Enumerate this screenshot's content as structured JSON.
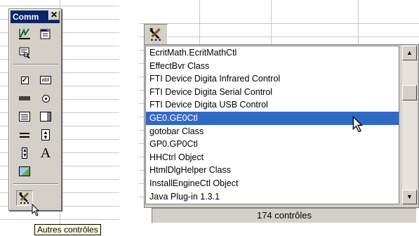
{
  "toolbox": {
    "title": "Comm",
    "close_label": "✕",
    "tooltip": "Autres contrôles"
  },
  "controls_list": {
    "items": [
      "EcritMath.EcritMathCtl",
      "EffectBvr Class",
      "FTI Device Digita Infrared Control",
      "FTI Device Digita Serial Control",
      "FTI Device Digita USB Control",
      "GE0.GE0Ctl",
      "gotobar Class",
      "GP0.GP0Ctl",
      "HHCtrl Object",
      "HtmlDlgHelper Class",
      "InstallEngineCtl Object",
      "Java Plug-in 1.3.1"
    ],
    "selected_index": 5,
    "count_label": "174 contrôles",
    "scroll_up_glyph": "▲",
    "scroll_down_glyph": "▼"
  },
  "colors": {
    "selection": "#316ac5",
    "title_bar": "#0a246a",
    "face": "#d4d0c8",
    "tooltip_bg": "#ffffe1"
  },
  "icons": {
    "toolbox_tools": "more-controls-icon",
    "list_tools": "more-controls-icon"
  }
}
